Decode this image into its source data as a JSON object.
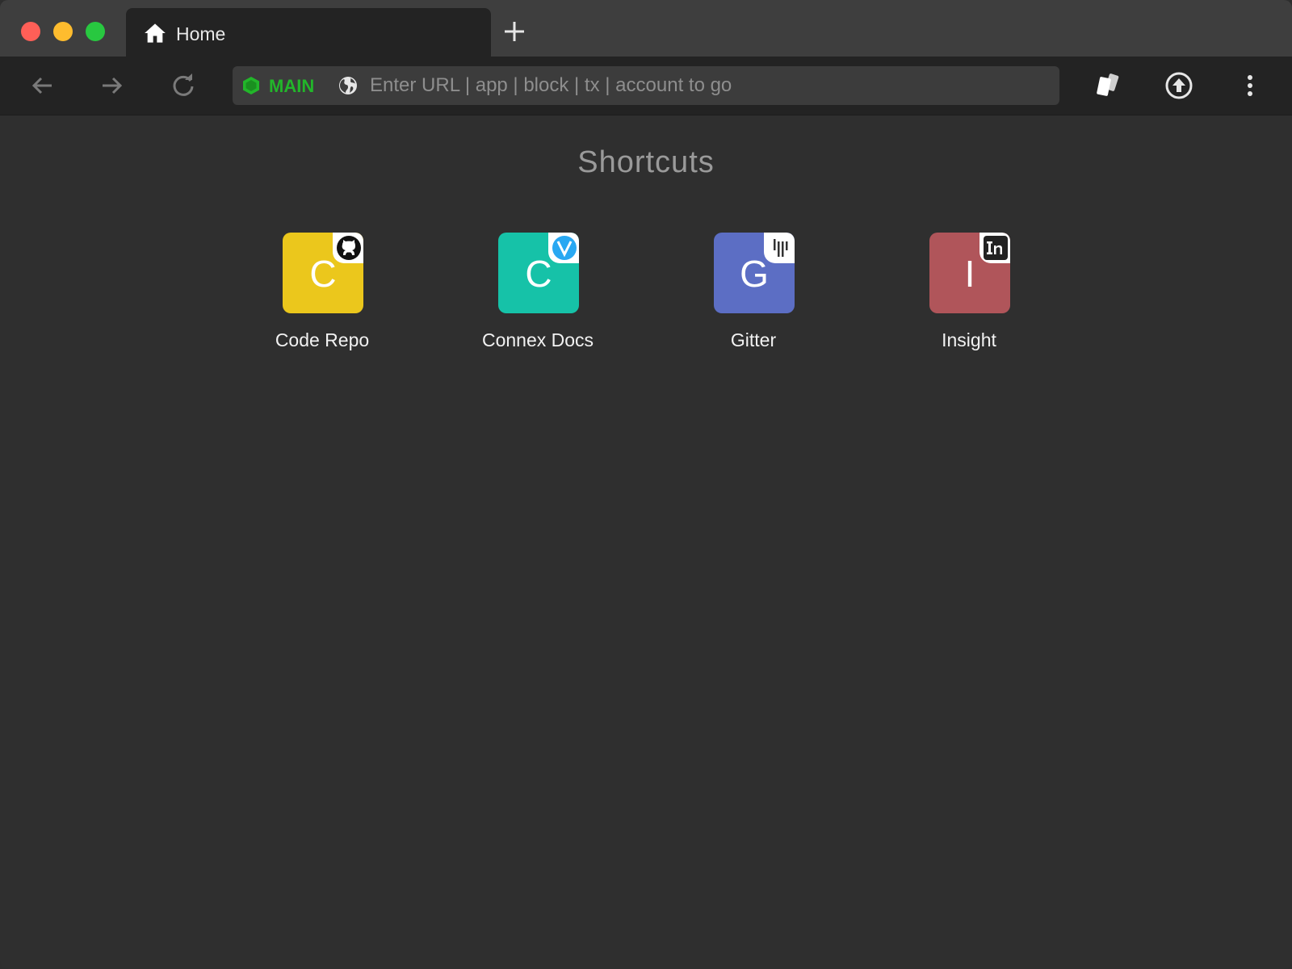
{
  "window": {
    "controls": {
      "close_color": "#ff5f57",
      "minimize_color": "#febc2e",
      "zoom_color": "#28c840"
    }
  },
  "tabs": [
    {
      "label": "Home",
      "icon": "home-icon",
      "active": true
    }
  ],
  "new_tab_icon": "plus-icon",
  "toolbar": {
    "back_icon": "arrow-left-icon",
    "forward_icon": "arrow-right-icon",
    "reload_icon": "reload-icon",
    "network": {
      "label": "MAIN",
      "color": "#22b62a",
      "icon": "hexagon-icon"
    },
    "address": {
      "icon": "globe-icon",
      "placeholder": "Enter URL | app | block | tx | account to go",
      "value": ""
    },
    "actions": [
      "cards-icon",
      "upload-icon",
      "more-vert-icon"
    ]
  },
  "shortcuts_section": {
    "title": "Shortcuts",
    "items": [
      {
        "label": "Code Repo",
        "letter": "C",
        "color": "#ebc71c",
        "badge_icon": "github-icon"
      },
      {
        "label": "Connex Docs",
        "letter": "C",
        "color": "#16c2a8",
        "badge_icon": "vuejs-icon"
      },
      {
        "label": "Gitter",
        "letter": "G",
        "color": "#5c6ec4",
        "badge_icon": "gitter-icon"
      },
      {
        "label": "Insight",
        "letter": "I",
        "color": "#b0555a",
        "badge_icon": "insight-icon"
      }
    ]
  }
}
